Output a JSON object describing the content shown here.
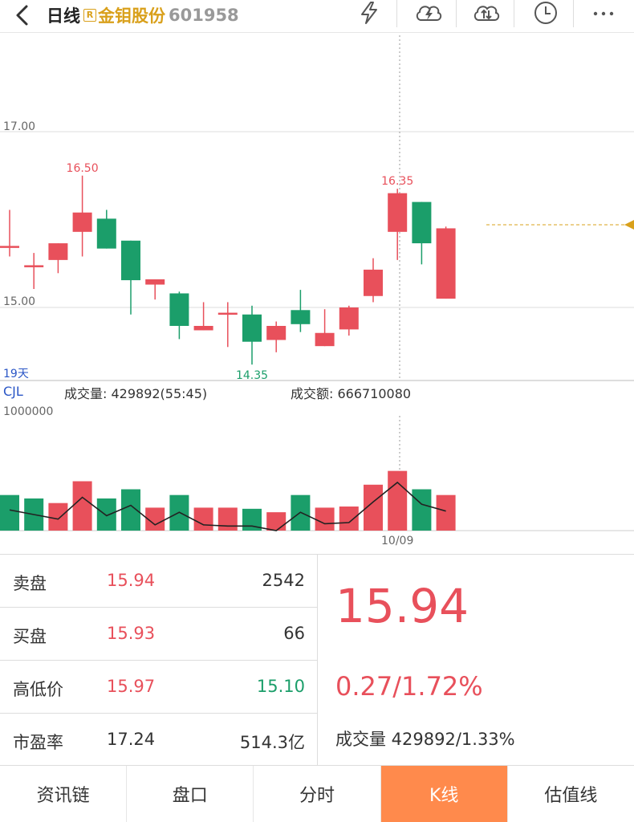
{
  "header": {
    "period": "日线",
    "badge": "R",
    "stock_name": "金钼股份",
    "stock_code": "601958",
    "icons": [
      "lightning-icon",
      "cloud-refresh-icon",
      "cloud-sync-icon",
      "clock-icon",
      "more-icon"
    ]
  },
  "chart_labels": {
    "days": "19天",
    "indicator": "CJL",
    "volume_text": "成交量: 429892(55:45)",
    "amount_text": "成交额: 666710080",
    "vol_scale": "1000000",
    "date_label": "10/09"
  },
  "colors": {
    "up": "#e8505b",
    "down": "#1b9e6a",
    "accent": "#ff8a4c",
    "gold": "#d9a01b"
  },
  "chart_data": [
    {
      "type": "candlestick",
      "title": "",
      "ylim": [
        14.1,
        17.4
      ],
      "y_grid": [
        17.0,
        15.0
      ],
      "grid": true,
      "annotations": [
        {
          "text": "16.50",
          "candle": 3
        },
        {
          "text": "16.35",
          "candle": 16
        },
        {
          "text": "14.35",
          "candle": 10
        }
      ],
      "dashed_price_line": 15.9,
      "candles": [
        {
          "o": 15.7,
          "c": 15.7,
          "h": 16.11,
          "l": 15.58
        },
        {
          "o": 15.48,
          "c": 15.48,
          "h": 15.62,
          "l": 15.21
        },
        {
          "o": 15.54,
          "c": 15.73,
          "h": 15.73,
          "l": 15.39
        },
        {
          "o": 15.86,
          "c": 16.08,
          "h": 16.5,
          "l": 15.58
        },
        {
          "o": 16.01,
          "c": 15.67,
          "h": 16.11,
          "l": 15.67
        },
        {
          "o": 15.76,
          "c": 15.31,
          "h": 15.76,
          "l": 14.92
        },
        {
          "o": 15.26,
          "c": 15.32,
          "h": 15.32,
          "l": 15.09
        },
        {
          "o": 15.16,
          "c": 14.79,
          "h": 15.18,
          "l": 14.64
        },
        {
          "o": 14.74,
          "c": 14.79,
          "h": 15.06,
          "l": 14.74
        },
        {
          "o": 14.92,
          "c": 14.94,
          "h": 15.06,
          "l": 14.55
        },
        {
          "o": 14.92,
          "c": 14.61,
          "h": 15.02,
          "l": 14.35
        },
        {
          "o": 14.63,
          "c": 14.79,
          "h": 14.84,
          "l": 14.49
        },
        {
          "o": 14.97,
          "c": 14.81,
          "h": 15.2,
          "l": 14.72
        },
        {
          "o": 14.56,
          "c": 14.71,
          "h": 14.98,
          "l": 14.56
        },
        {
          "o": 14.75,
          "c": 15.0,
          "h": 15.02,
          "l": 14.68
        },
        {
          "o": 15.13,
          "c": 15.43,
          "h": 15.56,
          "l": 15.06
        },
        {
          "o": 15.86,
          "c": 16.3,
          "h": 16.35,
          "l": 15.54
        },
        {
          "o": 16.2,
          "c": 15.73,
          "h": 16.2,
          "l": 15.49
        },
        {
          "o": 15.1,
          "c": 15.9,
          "h": 15.92,
          "l": 15.1
        }
      ]
    },
    {
      "type": "bar",
      "title": "成交量",
      "ylim": [
        0,
        1000000
      ],
      "values": [
        310000,
        280000,
        240000,
        430000,
        280000,
        360000,
        200000,
        310000,
        200000,
        200000,
        190000,
        160000,
        310000,
        200000,
        210000,
        400000,
        520000,
        360000,
        310000
      ],
      "colors": [
        "down",
        "down",
        "up",
        "up",
        "down",
        "down",
        "up",
        "down",
        "up",
        "up",
        "down",
        "up",
        "down",
        "up",
        "up",
        "up",
        "up",
        "down",
        "up"
      ],
      "line": [
        180000,
        140000,
        100000,
        290000,
        130000,
        220000,
        50000,
        160000,
        50000,
        40000,
        40000,
        0,
        160000,
        60000,
        70000,
        250000,
        420000,
        230000,
        170000
      ]
    }
  ],
  "quote": {
    "rows": [
      {
        "label": "卖盘",
        "v1": "15.94",
        "v2": "2542",
        "c1": "red",
        "c2": "dark"
      },
      {
        "label": "买盘",
        "v1": "15.93",
        "v2": "66",
        "c1": "red",
        "c2": "dark"
      },
      {
        "label": "高低价",
        "v1": "15.97",
        "v2": "15.10",
        "c1": "red",
        "c2": "green"
      },
      {
        "label": "市盈率",
        "v1": "17.24",
        "v2": "514.3亿",
        "c1": "dark",
        "c2": "dark"
      }
    ],
    "price": "15.94",
    "change": "0.27/1.72%",
    "volume_pct": "成交量 429892/1.33%"
  },
  "tabs": [
    {
      "label": "资讯链",
      "active": false
    },
    {
      "label": "盘口",
      "active": false
    },
    {
      "label": "分时",
      "active": false
    },
    {
      "label": "K线",
      "active": true
    },
    {
      "label": "估值线",
      "active": false
    }
  ]
}
